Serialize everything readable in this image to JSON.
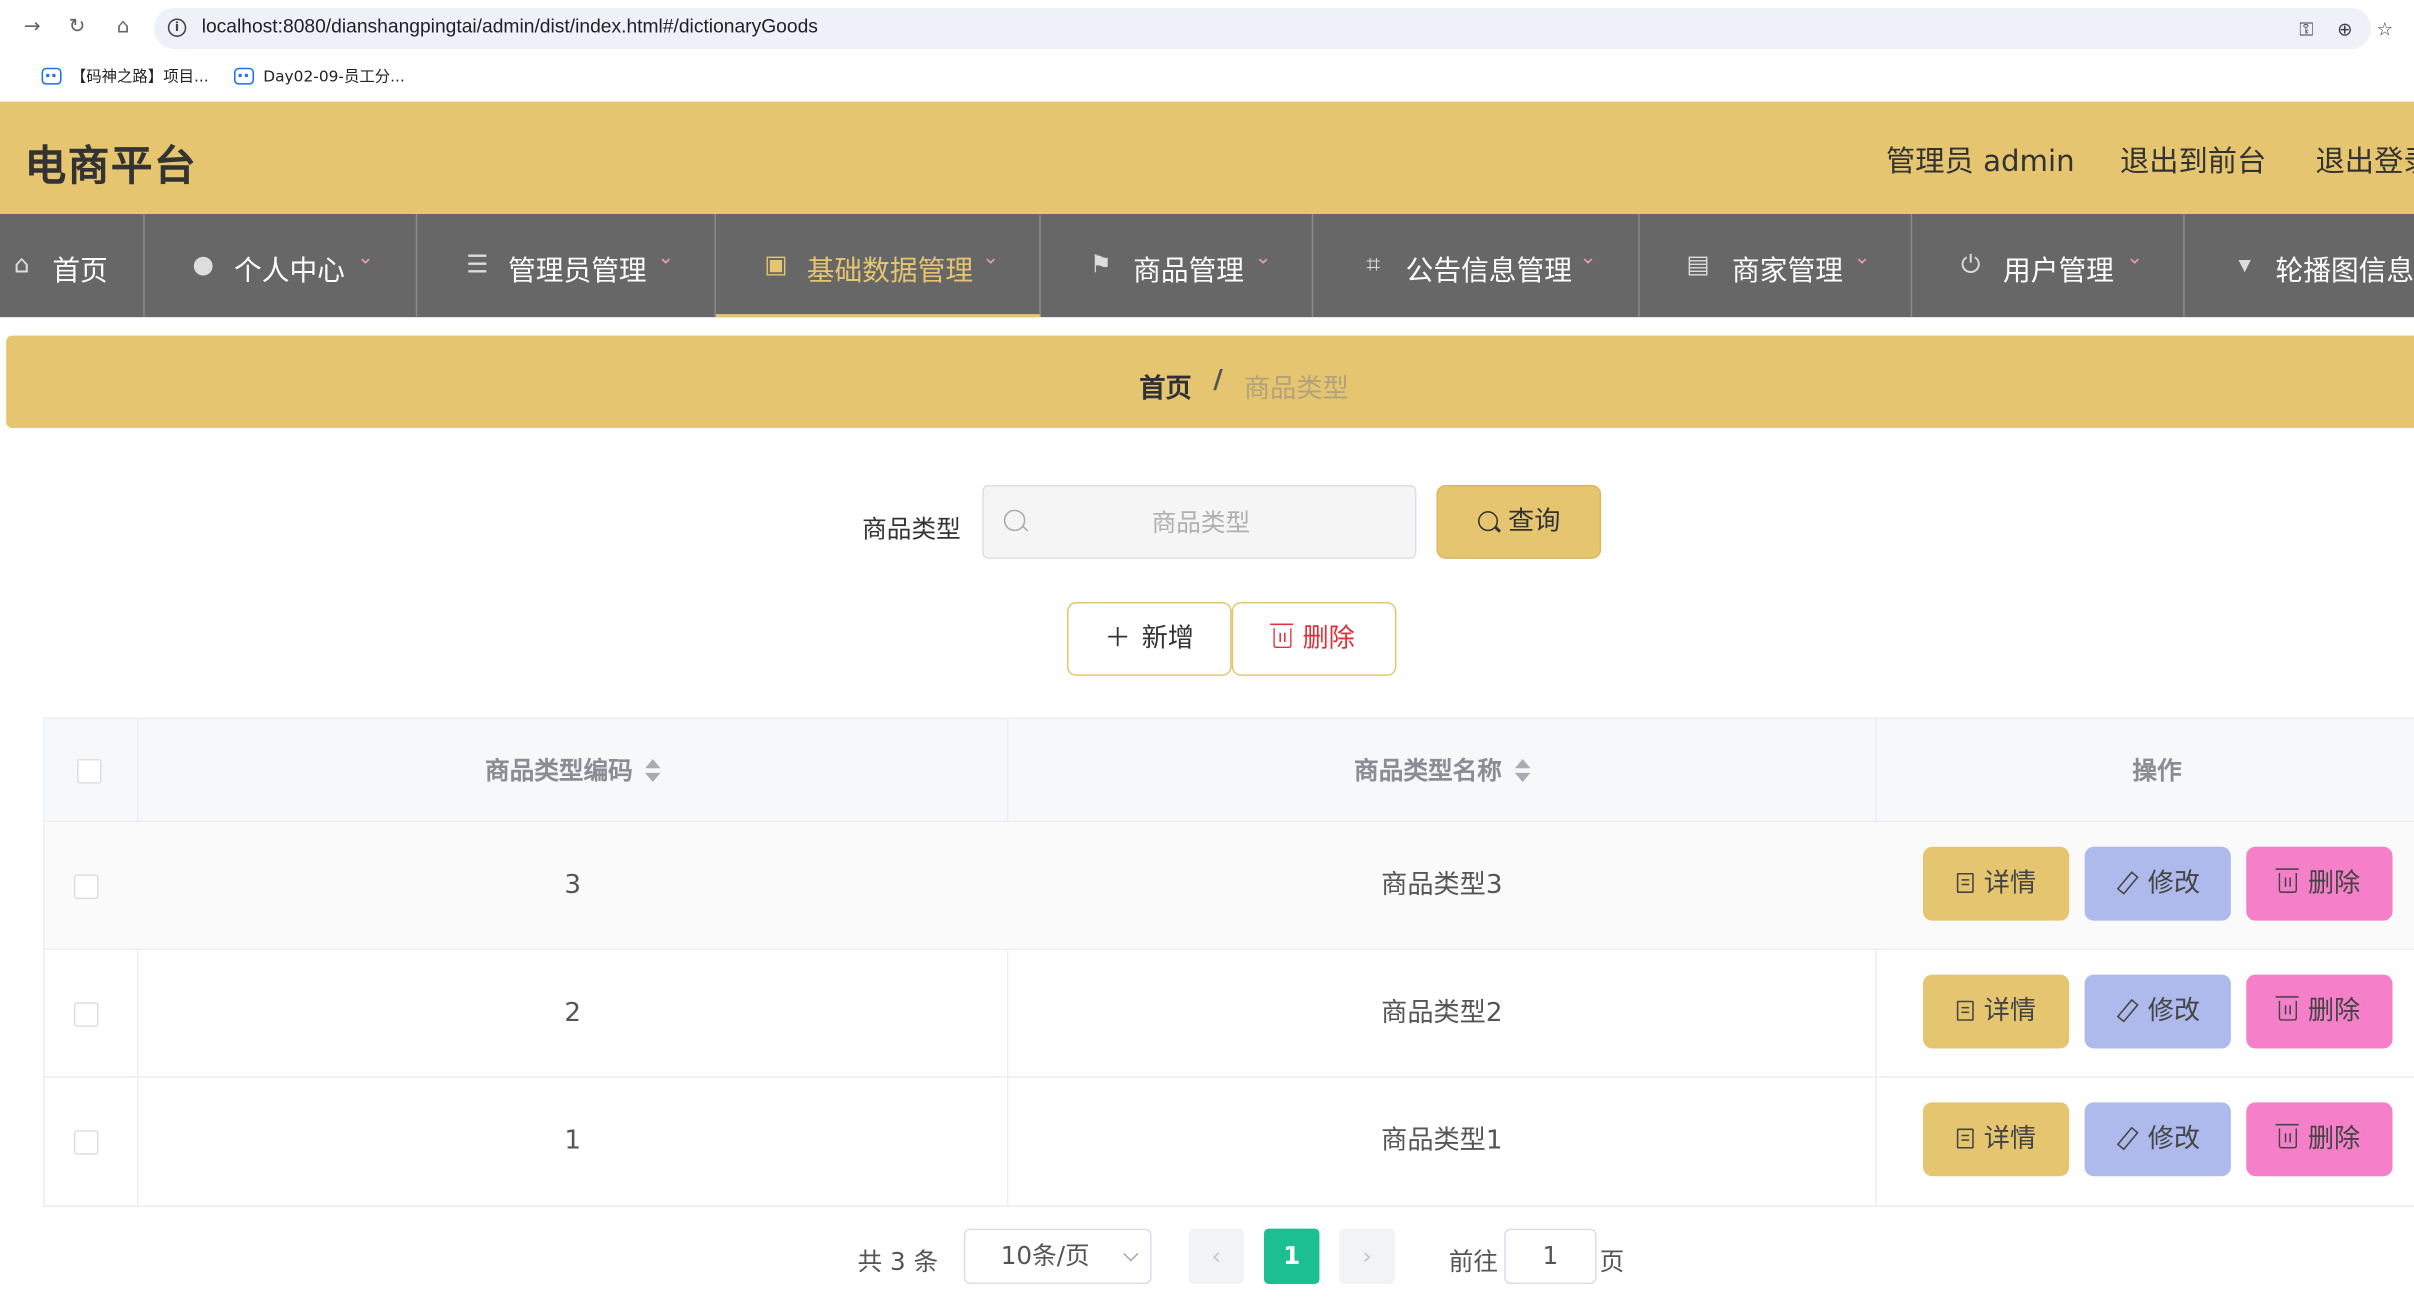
{
  "browser": {
    "url": "localhost:8080/dianshangpingtai/admin/dist/index.html#/dictionaryGoods",
    "bookmarks": [
      "【码神之路】项目...",
      "Day02-09-员工分..."
    ]
  },
  "header": {
    "title": "电商平台",
    "admin_label": "管理员 admin",
    "exit_front": "退出到前台",
    "logout": "退出登录"
  },
  "nav": {
    "items": [
      {
        "label": "首页",
        "icon": "home-icon"
      },
      {
        "label": "个人中心",
        "icon": "user-icon"
      },
      {
        "label": "管理员管理",
        "icon": "sliders-icon"
      },
      {
        "label": "基础数据管理",
        "icon": "briefcase-icon"
      },
      {
        "label": "商品管理",
        "icon": "flag-icon"
      },
      {
        "label": "公告信息管理",
        "icon": "crop-icon"
      },
      {
        "label": "商家管理",
        "icon": "clipboard-icon"
      },
      {
        "label": "用户管理",
        "icon": "power-icon"
      },
      {
        "label": "轮播图信息",
        "icon": "brush-icon"
      }
    ],
    "active_index": 3
  },
  "breadcrumb": {
    "home": "首页",
    "separator": "/",
    "current": "商品类型"
  },
  "search": {
    "label": "商品类型",
    "placeholder": "商品类型",
    "button": "查询"
  },
  "actions": {
    "add": "新增",
    "delete": "删除"
  },
  "table": {
    "columns": [
      "商品类型编码",
      "商品类型名称",
      "操作"
    ],
    "rows": [
      {
        "code": "3",
        "name": "商品类型3"
      },
      {
        "code": "2",
        "name": "商品类型2"
      },
      {
        "code": "1",
        "name": "商品类型1"
      }
    ],
    "row_actions": {
      "detail": "详情",
      "edit": "修改",
      "delete": "删除"
    }
  },
  "pagination": {
    "total": "共 3 条",
    "page_size": "10条/页",
    "current_page": "1",
    "goto_label": "前往",
    "goto_value": "1",
    "page_suffix": "页"
  },
  "colors": {
    "accent": "#e6c571",
    "nav_bg": "#676767",
    "edit": "#aebaeb",
    "danger": "#f57fc8",
    "page_active": "#1bbf92"
  }
}
